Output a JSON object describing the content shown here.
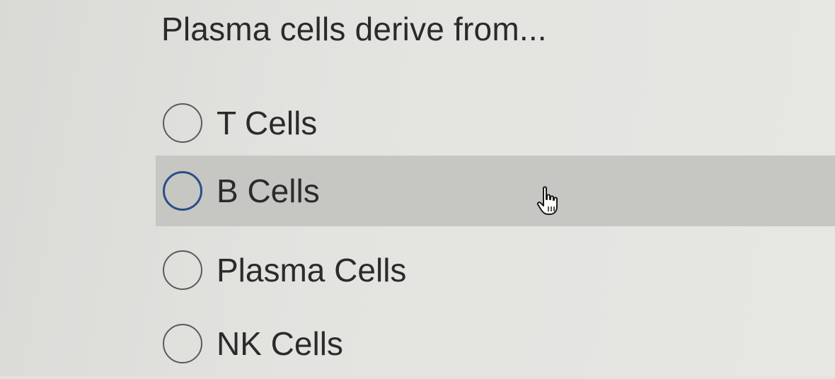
{
  "question": {
    "title": "Plasma cells derive from..."
  },
  "options": [
    {
      "label": "T Cells",
      "selected": false,
      "hovered": false
    },
    {
      "label": "B Cells",
      "selected": false,
      "hovered": true
    },
    {
      "label": "Plasma Cells",
      "selected": false,
      "hovered": false
    },
    {
      "label": "NK Cells",
      "selected": false,
      "hovered": false
    }
  ],
  "colors": {
    "background": "#e2e2df",
    "hover_row": "#c6c6c3",
    "hover_radio": "#2a4e86",
    "radio_border": "#5a5a5a",
    "text": "#2b2b2b"
  },
  "cursor": {
    "icon": "hand-pointer-icon"
  }
}
